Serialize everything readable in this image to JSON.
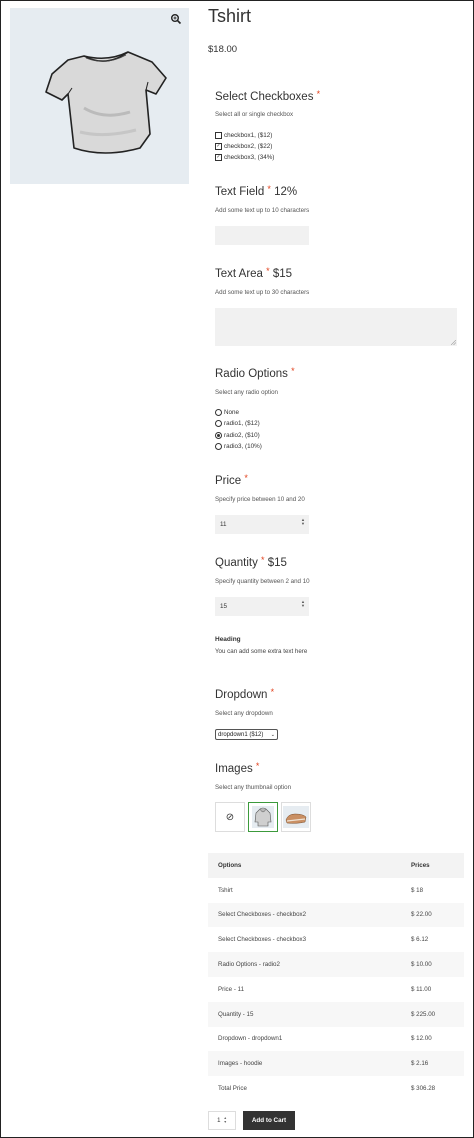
{
  "product": {
    "title": "Tshirt",
    "price": "$18.00",
    "zoom_icon": "magnifier-plus-icon"
  },
  "checkboxes": {
    "title": "Select Checkboxes",
    "required": "*",
    "desc": "Select all or single checkbox",
    "options": [
      {
        "label": "checkbox1, ($12)",
        "checked": false
      },
      {
        "label": "checkbox2, ($22)",
        "checked": true
      },
      {
        "label": "checkbox3, (34%)",
        "checked": true
      }
    ]
  },
  "text_field": {
    "title": "Text Field",
    "required": "*",
    "extra": "12%",
    "desc": "Add some text up to 10 characters",
    "value": ""
  },
  "text_area": {
    "title": "Text Area",
    "required": "*",
    "extra": "$15",
    "desc": "Add some text up to 30 characters",
    "value": ""
  },
  "radio": {
    "title": "Radio Options",
    "required": "*",
    "desc": "Select any radio option",
    "options": [
      {
        "label": "None",
        "checked": false
      },
      {
        "label": "radio1, ($12)",
        "checked": false
      },
      {
        "label": "radio2, ($10)",
        "checked": true
      },
      {
        "label": "radio3, (10%)",
        "checked": false
      }
    ]
  },
  "price_field": {
    "title": "Price",
    "required": "*",
    "desc": "Specify price between 10 and 20",
    "value": "11"
  },
  "quantity_field": {
    "title": "Quantity",
    "required": "*",
    "extra": "$15",
    "desc": "Specify quantity between 2 and 10",
    "value": "15"
  },
  "heading_block": {
    "heading": "Heading",
    "text": "You can add some extra text here"
  },
  "dropdown": {
    "title": "Dropdown",
    "required": "*",
    "desc": "Select any dropdown",
    "selected": "dropdown1 ($12)"
  },
  "images": {
    "title": "Images",
    "required": "*",
    "desc": "Select any thumbnail option",
    "none_symbol": "⊘"
  },
  "summary": {
    "headers": [
      "Options",
      "Prices"
    ],
    "rows": [
      [
        "Tshirt",
        "$ 18"
      ],
      [
        "Select Checkboxes - checkbox2",
        "$ 22.00"
      ],
      [
        "Select Checkboxes - checkbox3",
        "$ 6.12"
      ],
      [
        "Radio Options - radio2",
        "$ 10.00"
      ],
      [
        "Price - 11",
        "$ 11.00"
      ],
      [
        "Quantity - 15",
        "$ 225.00"
      ],
      [
        "Dropdown - dropdown1",
        "$ 12.00"
      ],
      [
        "Images - hoodie",
        "$ 2.16"
      ],
      [
        "Total Price",
        "$ 306.28"
      ]
    ]
  },
  "cart": {
    "qty": "1",
    "button": "Add to Cart"
  },
  "colors": {
    "accent_required": "#e2401c",
    "button_bg": "#333333",
    "image_bg": "#e6ecf1",
    "selected_thumb_border": "#3c9a3c"
  }
}
